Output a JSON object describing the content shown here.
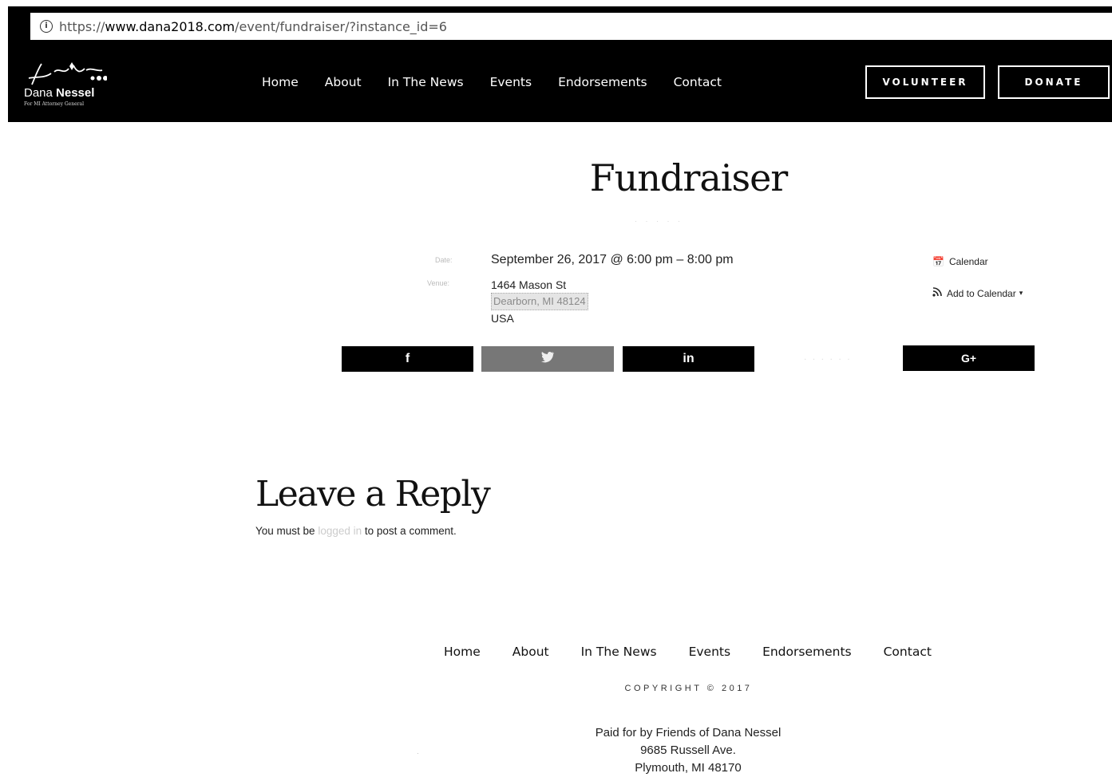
{
  "browser": {
    "url_scheme": "https://",
    "url_host": "www.dana2018.com",
    "url_path": "/event/fundraiser/?instance_id=6"
  },
  "logo": {
    "name_first": "Dana",
    "name_last": "Nessel",
    "tagline": "For MI Attorney General"
  },
  "nav": {
    "items": [
      "Home",
      "About",
      "In The News",
      "Events",
      "Endorsements",
      "Contact"
    ]
  },
  "header_buttons": {
    "volunteer": "VOLUNTEER",
    "donate": "DONATE"
  },
  "event": {
    "title": "Fundraiser",
    "date_label": "Date:",
    "venue_label": "Venue:",
    "date": "September 26, 2017 @ 6:00 pm – 8:00 pm",
    "address_line1": "1464 Mason St",
    "address_line2": "Dearborn, MI 48124",
    "country": "USA",
    "calendar_link": "Calendar",
    "add_to_calendar": "Add to Calendar"
  },
  "share": {
    "facebook": "f",
    "linkedin": "in",
    "googleplus": "G+"
  },
  "reply": {
    "title": "Leave a Reply",
    "prefix": "You must be",
    "link": "logged in",
    "suffix": "to post a comment."
  },
  "footer": {
    "nav": [
      "Home",
      "About",
      "In The News",
      "Events",
      "Endorsements",
      "Contact"
    ],
    "copyright": "COPYRIGHT © 2017",
    "paid_for_1": "Paid for by Friends of Dana Nessel",
    "paid_for_2": "9685 Russell Ave.",
    "paid_for_3": "Plymouth, MI 48170"
  },
  "colors": {
    "header_bg": "#000000",
    "page_bg": "#ffffff",
    "text": "#111111"
  }
}
